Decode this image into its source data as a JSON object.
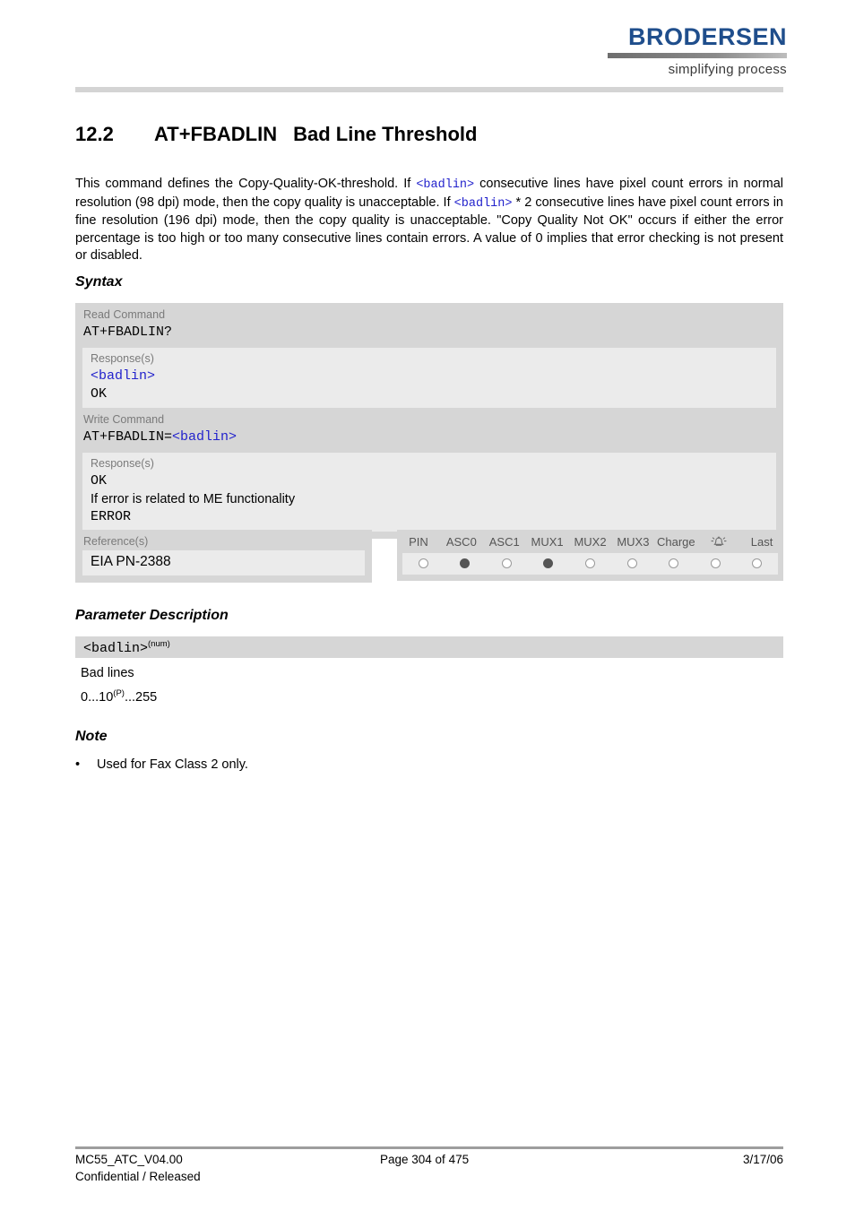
{
  "header": {
    "logo_word": "BRODERSEN",
    "logo_tagline": "simplifying process"
  },
  "section": {
    "number": "12.2",
    "command": "AT+FBADLIN",
    "title": "Bad Line Threshold"
  },
  "intro": {
    "part1": "This command defines the Copy-Quality-OK-threshold. If ",
    "ref1": "<badlin>",
    "part2": " consecutive lines have pixel count errors in normal resolution (98 dpi) mode, then the copy quality is unacceptable. If ",
    "ref2": "<badlin>",
    "part3": " * 2 consecutive lines have pixel count errors in fine resolution (196 dpi) mode, then the copy quality is unacceptable. \"Copy Quality Not OK\" occurs if either the error percentage is too high or too many consecutive lines contain errors. A value of 0 implies that error checking is not present or disabled."
  },
  "headings": {
    "syntax": "Syntax",
    "parameter_description": "Parameter Description",
    "note": "Note"
  },
  "syntax": {
    "read": {
      "label": "Read Command",
      "command": "AT+FBADLIN?",
      "response_label": "Response(s)",
      "response_param": "<badlin>",
      "response_ok": "OK"
    },
    "write": {
      "label": "Write Command",
      "command_prefix": "AT+FBADLIN=",
      "command_param": "<badlin>",
      "response_label": "Response(s)",
      "response_ok": "OK",
      "response_error_note": "If error is related to ME functionality",
      "response_error": "ERROR"
    },
    "reference": {
      "label": "Reference(s)",
      "value": "EIA PN-2388"
    }
  },
  "indicators": {
    "columns": [
      {
        "label": "PIN",
        "state": "off"
      },
      {
        "label": "ASC0",
        "state": "on"
      },
      {
        "label": "ASC1",
        "state": "off"
      },
      {
        "label": "MUX1",
        "state": "on"
      },
      {
        "label": "MUX2",
        "state": "off"
      },
      {
        "label": "MUX3",
        "state": "off"
      },
      {
        "label": "Charge",
        "state": "off"
      },
      {
        "label": "",
        "icon": "alarm-icon",
        "state": "off"
      },
      {
        "label": "Last",
        "state": "off"
      }
    ]
  },
  "parameter": {
    "name": "<badlin>",
    "type": "(num)",
    "description": "Bad lines",
    "range_prefix": "0...10",
    "range_sup": "(P)",
    "range_suffix": "...255"
  },
  "note": {
    "bullet": "•",
    "text": "Used for Fax Class 2 only."
  },
  "footer": {
    "document": "MC55_ATC_V04.00",
    "classification": "Confidential / Released",
    "page": "Page 304 of 475",
    "date": "3/17/06"
  },
  "colors": {
    "brand_blue": "#1f4e8c",
    "param_blue": "#2222cc",
    "block_gray": "#d6d6d6",
    "panel_gray": "#ebebeb"
  }
}
